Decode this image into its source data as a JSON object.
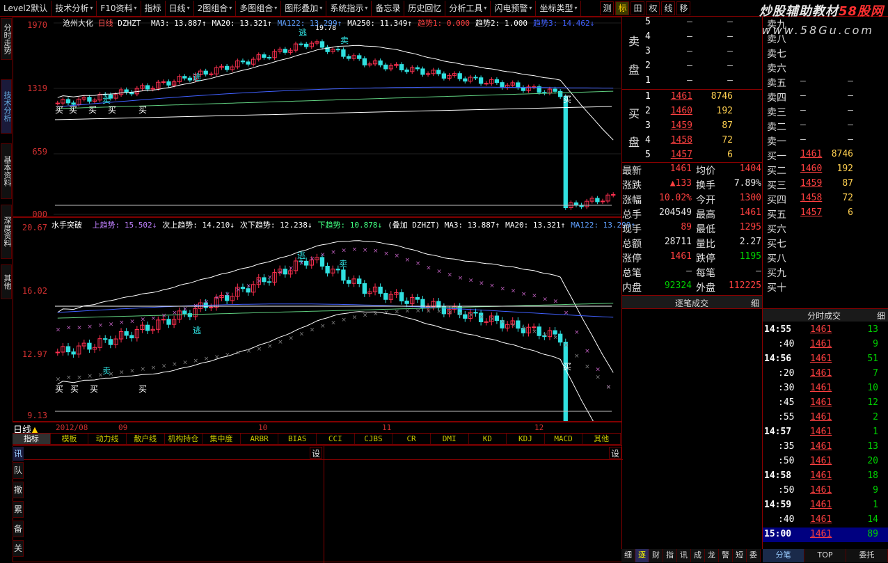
{
  "toolbar": {
    "items": [
      "Level2默认",
      "技术分析",
      "F10资料",
      "指标",
      "日线",
      "2图组合",
      "多图组合",
      "图形叠加",
      "系统指示",
      "备忘录",
      "历史回忆",
      "分析工具",
      "闪电预警",
      "坐标类型"
    ],
    "right_buttons": [
      "测",
      "标",
      "田",
      "权",
      "线",
      "移"
    ],
    "active_right": "标"
  },
  "watermark": {
    "brand_a": "炒股辅助教材",
    "brand_b": "58股网",
    "site": "www.58Gu.com"
  },
  "left_tabs": [
    "分时走势",
    "技术分析",
    "基本资料",
    "深度资料",
    "其他"
  ],
  "main_chart": {
    "stock_name": "沧州大化",
    "period": "日线",
    "indicator": "DZHZT",
    "legend": [
      {
        "text": "MA3: 13.887↑",
        "color": "#ffffff"
      },
      {
        "text": "MA20: 13.321↑",
        "color": "#ffffff"
      },
      {
        "text": "MA122: 13.299↑",
        "color": "#60a0ff"
      },
      {
        "text": "MA250: 11.349↑",
        "color": "#ffffff"
      },
      {
        "text": "趋势1: 0.000",
        "color": "#ff4040"
      },
      {
        "text": "趋势2: 1.000",
        "color": "#ffffff"
      },
      {
        "text": "趋势3: 14.462↓",
        "color": "#4060ff"
      }
    ],
    "y_labels": [
      "1970",
      "1319",
      "659",
      "000"
    ],
    "peak_label": "19.78"
  },
  "sub_chart": {
    "title": "水手突破",
    "legend": [
      {
        "text": "上趋势: 15.502↓",
        "color": "#c080ff"
      },
      {
        "text": "次上趋势: 14.210↓",
        "color": "#ffffff"
      },
      {
        "text": "次下趋势: 12.238↓",
        "color": "#ffffff"
      },
      {
        "text": "下趋势: 10.878↓",
        "color": "#40ff80"
      },
      {
        "text": "(叠加 DZHZT) MA3: 13.887↑",
        "color": "#ffffff"
      },
      {
        "text": "MA20: 13.321↑",
        "color": "#ffffff"
      },
      {
        "text": "MA122: 13.299↑",
        "color": "#60a0ff"
      }
    ],
    "y_labels": [
      "20.67",
      "16.02",
      "12.97",
      "9.13"
    ]
  },
  "signals": {
    "buy": "买",
    "sell": "卖",
    "escape": "逃"
  },
  "x_axis": {
    "period_label": "日线",
    "labels": [
      "2012/08",
      "09",
      "10",
      "11",
      "12"
    ]
  },
  "indicator_tabs": [
    "指标",
    "模板",
    "动力线",
    "散户线",
    "机构持仓",
    "集中度",
    "ARBR",
    "BIAS",
    "CCI",
    "CJBS",
    "CR",
    "DMI",
    "KD",
    "KDJ",
    "MACD",
    "其他"
  ],
  "lower_panel": {
    "left_tab": "讯",
    "set_label": "设",
    "side_tabs": [
      "队",
      "撤",
      "累",
      "备",
      "关"
    ]
  },
  "order_book": {
    "sell_label": [
      "卖",
      "盘"
    ],
    "buy_label": [
      "买",
      "盘"
    ],
    "sell": [
      {
        "lvl": "5",
        "price": "–",
        "vol": "–"
      },
      {
        "lvl": "4",
        "price": "–",
        "vol": "–"
      },
      {
        "lvl": "3",
        "price": "–",
        "vol": "–"
      },
      {
        "lvl": "2",
        "price": "–",
        "vol": "–"
      },
      {
        "lvl": "1",
        "price": "–",
        "vol": "–"
      }
    ],
    "buy": [
      {
        "lvl": "1",
        "price": "1461",
        "vol": "8746"
      },
      {
        "lvl": "2",
        "price": "1460",
        "vol": "192"
      },
      {
        "lvl": "3",
        "price": "1459",
        "vol": "87"
      },
      {
        "lvl": "4",
        "price": "1458",
        "vol": "72"
      },
      {
        "lvl": "5",
        "price": "1457",
        "vol": "6"
      }
    ]
  },
  "quote": [
    {
      "k1": "最新",
      "v1": "1461",
      "c1": "red",
      "k2": "均价",
      "v2": "1404",
      "c2": "red"
    },
    {
      "k1": "涨跌",
      "v1": "▲133",
      "c1": "red",
      "k2": "换手",
      "v2": "7.89%",
      "c2": "wht"
    },
    {
      "k1": "涨幅",
      "v1": "10.02%",
      "c1": "red",
      "k2": "今开",
      "v2": "1300",
      "c2": "red"
    },
    {
      "k1": "总手",
      "v1": "204549",
      "c1": "wht",
      "k2": "最高",
      "v2": "1461",
      "c2": "red"
    },
    {
      "k1": "现手",
      "v1": "89",
      "c1": "red",
      "k2": "最低",
      "v2": "1295",
      "c2": "red"
    },
    {
      "k1": "总额",
      "v1": "28711",
      "c1": "wht",
      "k2": "量比",
      "v2": "2.27",
      "c2": "wht"
    },
    {
      "k1": "涨停",
      "v1": "1461",
      "c1": "red",
      "k2": "跌停",
      "v2": "1195",
      "c2": "green"
    },
    {
      "k1": "总笔",
      "v1": "–",
      "c1": "wht",
      "k2": "每笔",
      "v2": "–",
      "c2": "wht"
    },
    {
      "k1": "内盘",
      "v1": "92324",
      "c1": "green",
      "k2": "外盘",
      "v2": "112225",
      "c2": "red"
    }
  ],
  "deal_header": "逐笔成交",
  "deal_tab": "细",
  "level10": {
    "sell": [
      {
        "k": "卖九",
        "p": "",
        "v": ""
      },
      {
        "k": "卖八",
        "p": "",
        "v": ""
      },
      {
        "k": "卖七",
        "p": "",
        "v": ""
      },
      {
        "k": "卖六",
        "p": "",
        "v": ""
      },
      {
        "k": "卖五",
        "p": "–",
        "v": "–"
      },
      {
        "k": "卖四",
        "p": "–",
        "v": "–"
      },
      {
        "k": "卖三",
        "p": "–",
        "v": "–"
      },
      {
        "k": "卖二",
        "p": "–",
        "v": "–"
      },
      {
        "k": "卖一",
        "p": "–",
        "v": "–"
      }
    ],
    "buy": [
      {
        "k": "买一",
        "p": "1461",
        "v": "8746"
      },
      {
        "k": "买二",
        "p": "1460",
        "v": "192"
      },
      {
        "k": "买三",
        "p": "1459",
        "v": "87"
      },
      {
        "k": "买四",
        "p": "1458",
        "v": "72"
      },
      {
        "k": "买五",
        "p": "1457",
        "v": "6"
      },
      {
        "k": "买六",
        "p": "",
        "v": ""
      },
      {
        "k": "买七",
        "p": "",
        "v": ""
      },
      {
        "k": "买八",
        "p": "",
        "v": ""
      },
      {
        "k": "买九",
        "p": "",
        "v": ""
      },
      {
        "k": "买十",
        "p": "",
        "v": ""
      }
    ]
  },
  "ticks_header": "分时成交",
  "ticks_tab": "细",
  "ticks": [
    {
      "t": "14:55",
      "p": "1461",
      "v": "13",
      "major": true
    },
    {
      "t": ":40",
      "p": "1461",
      "v": "9",
      "major": false
    },
    {
      "t": "14:56",
      "p": "1461",
      "v": "51",
      "major": true
    },
    {
      "t": ":20",
      "p": "1461",
      "v": "7",
      "major": false
    },
    {
      "t": ":30",
      "p": "1461",
      "v": "10",
      "major": false
    },
    {
      "t": ":45",
      "p": "1461",
      "v": "12",
      "major": false
    },
    {
      "t": ":55",
      "p": "1461",
      "v": "2",
      "major": false
    },
    {
      "t": "14:57",
      "p": "1461",
      "v": "1",
      "major": true
    },
    {
      "t": ":35",
      "p": "1461",
      "v": "13",
      "major": false
    },
    {
      "t": ":50",
      "p": "1461",
      "v": "20",
      "major": false
    },
    {
      "t": "14:58",
      "p": "1461",
      "v": "18",
      "major": true
    },
    {
      "t": ":50",
      "p": "1461",
      "v": "9",
      "major": false
    },
    {
      "t": "14:59",
      "p": "1461",
      "v": "1",
      "major": true
    },
    {
      "t": ":40",
      "p": "1461",
      "v": "14",
      "major": false
    },
    {
      "t": "15:00",
      "p": "1461",
      "v": "89",
      "major": true
    }
  ],
  "bottom_tabs": [
    "细",
    "逐",
    "财",
    "指",
    "讯",
    "成",
    "龙",
    "警",
    "短",
    "委"
  ],
  "bottom_tabs_active": "逐",
  "tick_tabs": [
    "分笔",
    "TOP",
    "委托"
  ]
}
